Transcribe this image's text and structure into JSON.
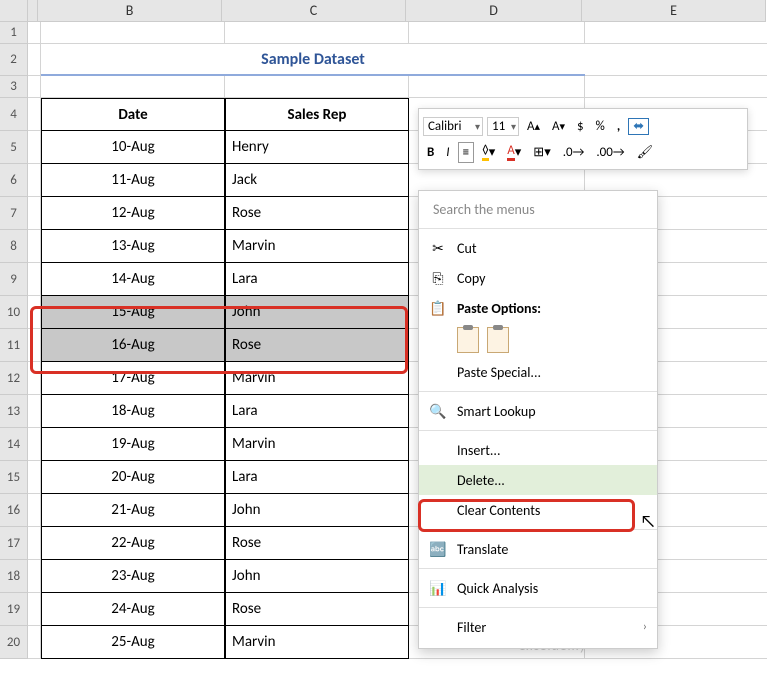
{
  "columns": [
    "B",
    "C",
    "D",
    "E"
  ],
  "title": "Sample Dataset",
  "headers": {
    "date": "Date",
    "rep": "Sales Rep"
  },
  "rows": [
    {
      "n": 5,
      "date": "10-Aug",
      "rep": "Henry"
    },
    {
      "n": 6,
      "date": "11-Aug",
      "rep": "Jack"
    },
    {
      "n": 7,
      "date": "12-Aug",
      "rep": "Rose"
    },
    {
      "n": 8,
      "date": "13-Aug",
      "rep": "Marvin"
    },
    {
      "n": 9,
      "date": "14-Aug",
      "rep": "Lara"
    },
    {
      "n": 10,
      "date": "15-Aug",
      "rep": "John",
      "sel": true
    },
    {
      "n": 11,
      "date": "16-Aug",
      "rep": "Rose",
      "sel": true
    },
    {
      "n": 12,
      "date": "17-Aug",
      "rep": "Marvin"
    },
    {
      "n": 13,
      "date": "18-Aug",
      "rep": "Lara"
    },
    {
      "n": 14,
      "date": "19-Aug",
      "rep": "Marvin"
    },
    {
      "n": 15,
      "date": "20-Aug",
      "rep": "Lara"
    },
    {
      "n": 16,
      "date": "21-Aug",
      "rep": "John"
    },
    {
      "n": 17,
      "date": "22-Aug",
      "rep": "Rose"
    },
    {
      "n": 18,
      "date": "23-Aug",
      "rep": "John"
    },
    {
      "n": 19,
      "date": "24-Aug",
      "rep": "Rose"
    },
    {
      "n": 20,
      "date": "25-Aug",
      "rep": "Marvin"
    }
  ],
  "mini_toolbar": {
    "font": "Calibri",
    "size": "11"
  },
  "context_menu": {
    "search_placeholder": "Search the menus",
    "cut": "Cut",
    "copy": "Copy",
    "paste_options": "Paste Options:",
    "paste_special": "Paste Special...",
    "smart_lookup": "Smart Lookup",
    "insert": "Insert...",
    "delete": "Delete...",
    "clear_contents": "Clear Contents",
    "translate": "Translate",
    "quick_analysis": "Quick Analysis",
    "filter": "Filter"
  },
  "watermark": "exceldemy"
}
